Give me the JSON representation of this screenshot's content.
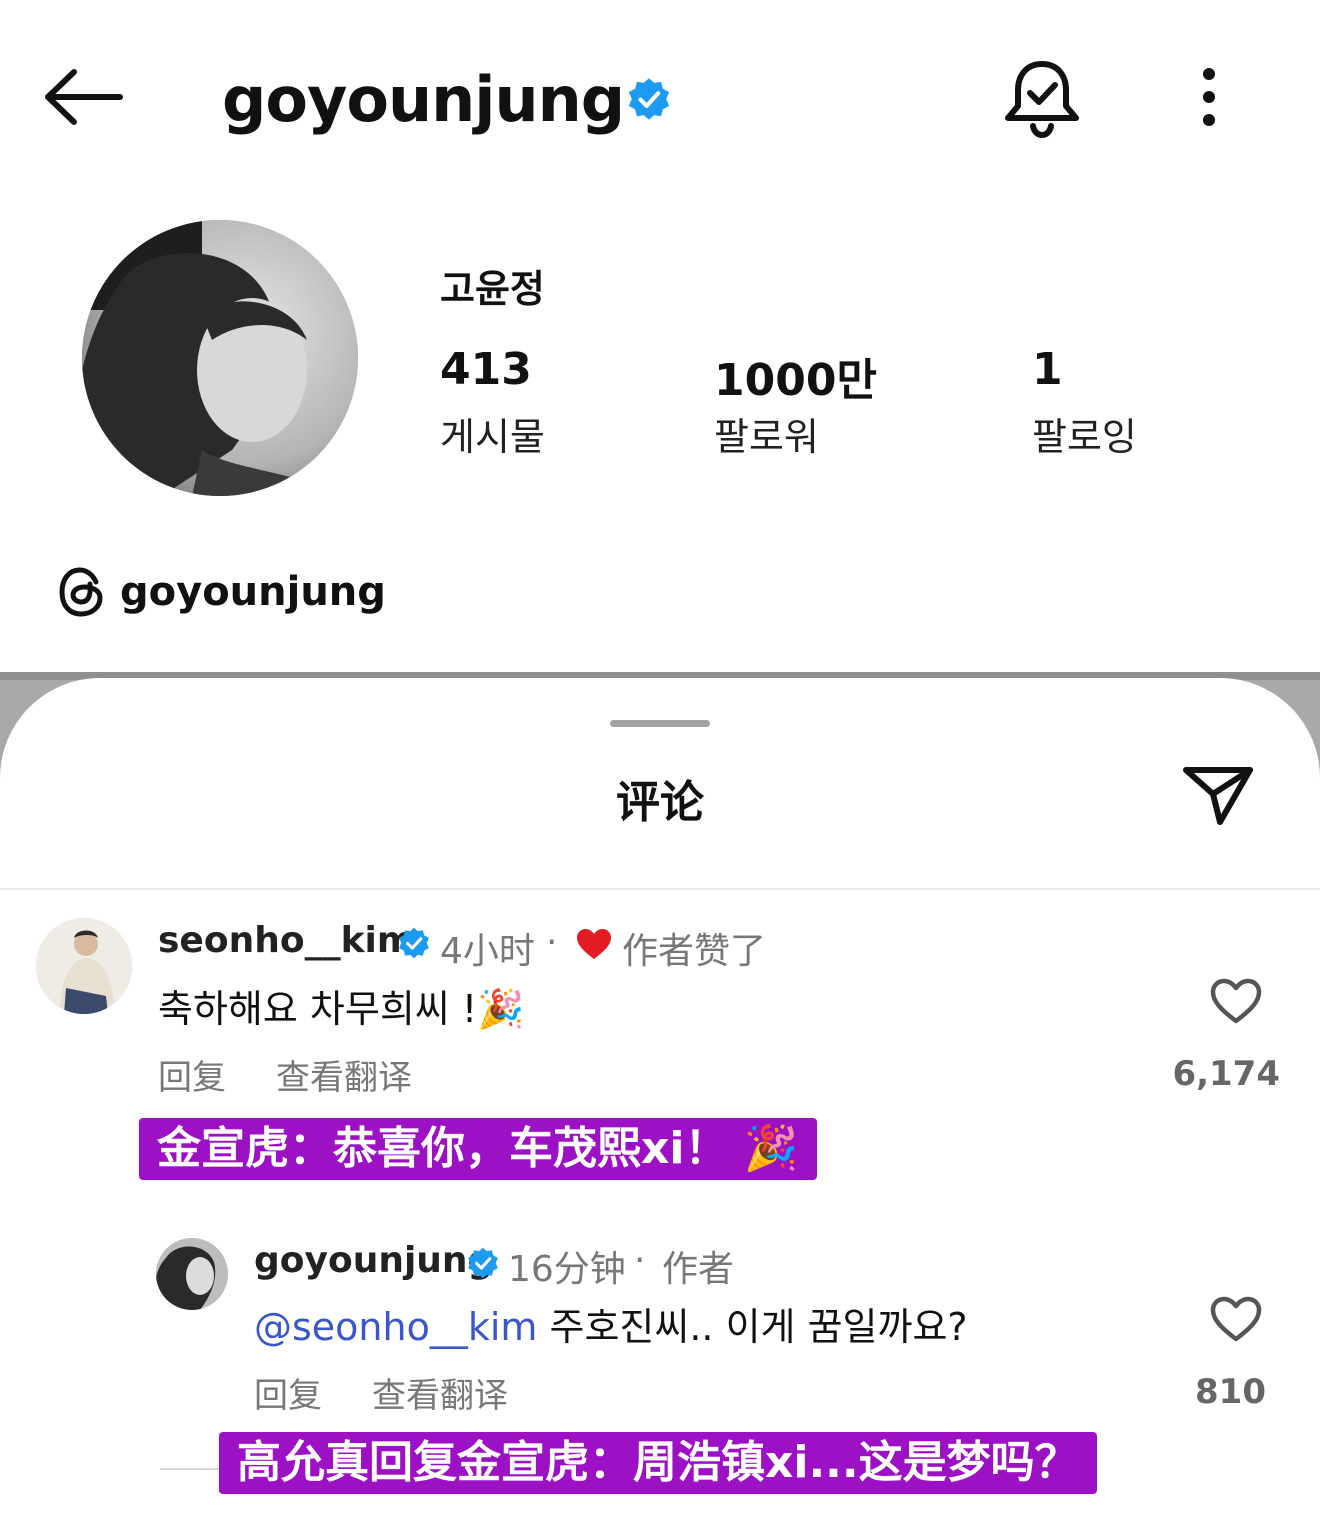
{
  "header": {
    "username": "goyounjung",
    "verified_color": "#1d9bf0"
  },
  "profile": {
    "display_name": "고윤정",
    "stats": [
      {
        "value": "413",
        "label": "게시물"
      },
      {
        "value": "1000만",
        "label": "팔로워"
      },
      {
        "value": "1",
        "label": "팔로잉"
      }
    ],
    "threads_handle": "goyounjung"
  },
  "sheet": {
    "title": "评论"
  },
  "comments": [
    {
      "username": "seonho__kim",
      "time": "4小时",
      "dot": "·",
      "author_liked": "作者赞了",
      "text": "축하해요 차무희씨 !🎉",
      "reply": "回复",
      "translate": "查看翻译",
      "likes": "6,174",
      "subtitle": "金宣虎：恭喜你，车茂熙xi！ 🎉"
    },
    {
      "username": "goyounjung",
      "time": "16分钟",
      "dot": "·",
      "author_tag": "作者",
      "mention": "@seonho__kim",
      "text": " 주호진씨.. 이게 꿈일까요?",
      "reply": "回复",
      "translate": "查看翻译",
      "likes": "810",
      "subtitle": "高允真回复金宣虎：周浩镇xi...这是梦吗？"
    }
  ]
}
